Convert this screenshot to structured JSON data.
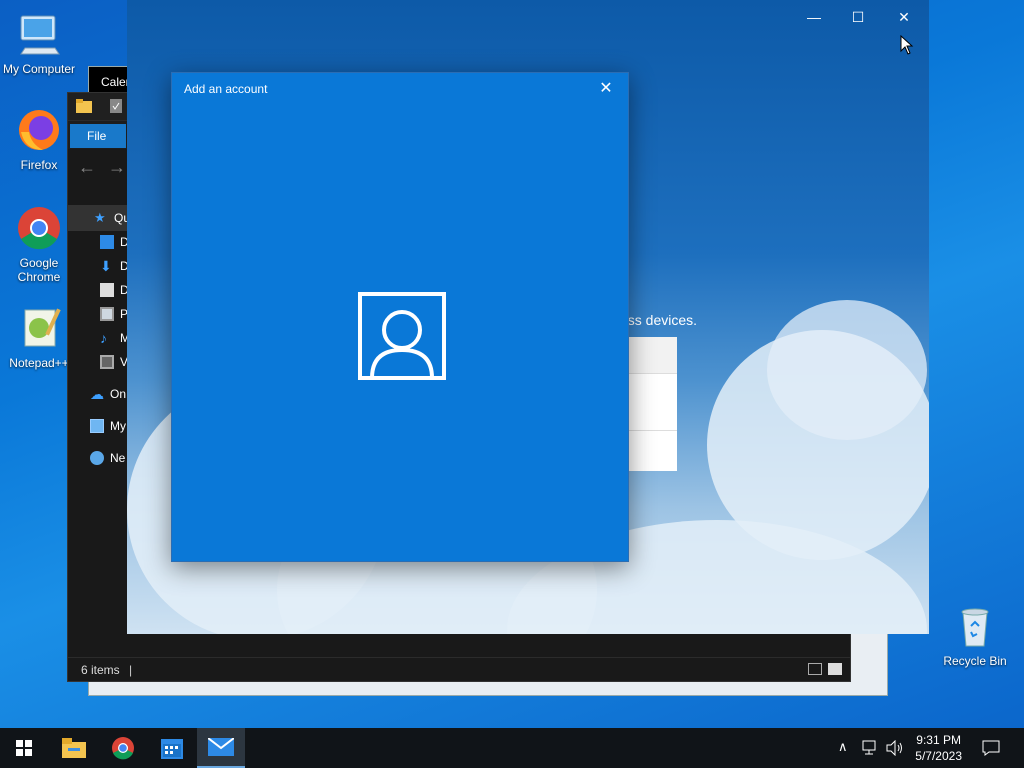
{
  "desktop": {
    "icons": [
      {
        "label": "My Computer",
        "icon": "computer-icon"
      },
      {
        "label": "Firefox",
        "icon": "firefox-icon"
      },
      {
        "label": "Google Chrome",
        "icon": "chrome-icon"
      },
      {
        "label": "Notepad++",
        "icon": "notepadpp-icon"
      },
      {
        "label": "Recycle Bin",
        "icon": "recycle-bin-icon"
      }
    ]
  },
  "calendar_window": {
    "title": "Calen"
  },
  "explorer": {
    "file_tab": "File",
    "nav": [
      {
        "label": "Qu",
        "icon": "star-icon"
      },
      {
        "label": "D",
        "icon": "desktop-folder-icon"
      },
      {
        "label": "D",
        "icon": "download-icon"
      },
      {
        "label": "D",
        "icon": "document-icon"
      },
      {
        "label": "P",
        "icon": "pictures-icon"
      },
      {
        "label": "M",
        "icon": "music-icon"
      },
      {
        "label": "V",
        "icon": "video-icon"
      },
      {
        "label": "On",
        "icon": "onedrive-icon"
      },
      {
        "label": "My",
        "icon": "computer-icon"
      },
      {
        "label": "Ne",
        "icon": "network-icon"
      }
    ],
    "status": "6 items"
  },
  "mail_window": {
    "bg_text": "oss devices."
  },
  "dialog": {
    "title": "Add an account",
    "close_icon": "close-icon",
    "center_icon": "person-icon"
  },
  "taskbar": {
    "time": "9:31 PM",
    "date": "5/7/2023",
    "apps": [
      "start-icon",
      "file-explorer-icon",
      "chrome-icon",
      "calendar-icon",
      "mail-icon"
    ]
  },
  "colors": {
    "dialog_bg": "#0a78d7",
    "taskbar_bg": "#101418",
    "explorer_bg": "#191919",
    "accent": "#1979ca"
  }
}
